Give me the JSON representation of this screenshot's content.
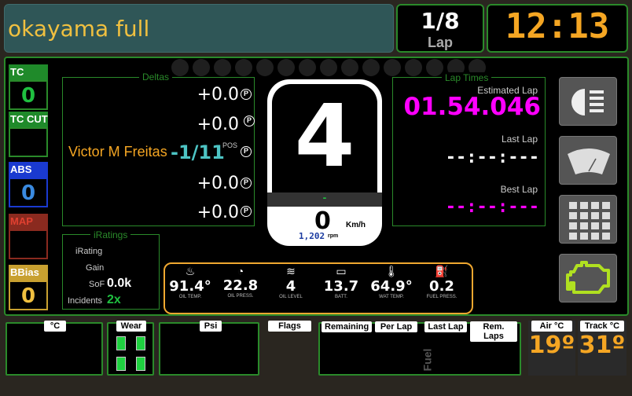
{
  "header": {
    "track": "okayama full",
    "lap": "1/8",
    "lap_label": "Lap",
    "clock": "12:13"
  },
  "side": {
    "tc": {
      "label": "TC",
      "value": "0"
    },
    "tc_cut": {
      "label": "TC CUT",
      "value": ""
    },
    "abs": {
      "label": "ABS",
      "value": "0"
    },
    "map": {
      "label": "MAP",
      "value": ""
    },
    "bbias": {
      "label": "BBias",
      "value": "0"
    }
  },
  "deltas": {
    "title": "Deltas",
    "rows": [
      "+0.0",
      "+0.0",
      "+0.0",
      "+0.0"
    ],
    "p_glyph": "P",
    "driver": "Victor M Freitas",
    "position": "-1/11",
    "pos_label": "POS"
  },
  "iratings": {
    "title": "iRatings",
    "irating_label": "iRating",
    "gain_label": "Gain",
    "sof_label": "SoF",
    "sof_value": "0.0k",
    "incidents_label": "Incidents",
    "incidents_value": "2x"
  },
  "gear": {
    "value": "4",
    "indicator": "-",
    "speed": "0",
    "speed_unit": "Km/h",
    "rpm": "1,202",
    "rpm_unit": "rpm"
  },
  "lap_times": {
    "title": "Lap Times",
    "estimated_label": "Estimated Lap",
    "estimated": "01.54.046",
    "last_label": "Last Lap",
    "last": "--:--:---",
    "best_label": "Best Lap",
    "best": "--:--:---"
  },
  "sensors": [
    {
      "value": "91.4°",
      "label": "OIL TEMP.",
      "icon": "oil-temp-icon"
    },
    {
      "value": "22.8",
      "label": "OIL PRESS.",
      "icon": "oil-press-icon"
    },
    {
      "value": "4",
      "label": "OIL LEVEL",
      "icon": "oil-level-icon"
    },
    {
      "value": "13.7",
      "label": "BATT.",
      "icon": "battery-icon"
    },
    {
      "value": "64.9°",
      "label": "WAT TEMP.",
      "icon": "water-temp-icon"
    },
    {
      "value": "0.2",
      "label": "FUEL PRESS.",
      "icon": "fuel-press-icon"
    }
  ],
  "bottom": {
    "celsius": "°C",
    "wear": "Wear",
    "psi": "Psi",
    "flags": "Flags",
    "remaining": "Remaining",
    "per_lap": "Per Lap",
    "last_lap": "Last Lap",
    "rem_laps": "Rem. Laps",
    "fuel_label": "Fuel",
    "air_label": "Air °C",
    "air_value": "19º",
    "track_label": "Track °C",
    "track_value": "31º"
  },
  "colors": {
    "green": "#2a8a2a",
    "orange": "#f5a623",
    "magenta": "#ff00ff",
    "teal": "#4dc4c4"
  }
}
